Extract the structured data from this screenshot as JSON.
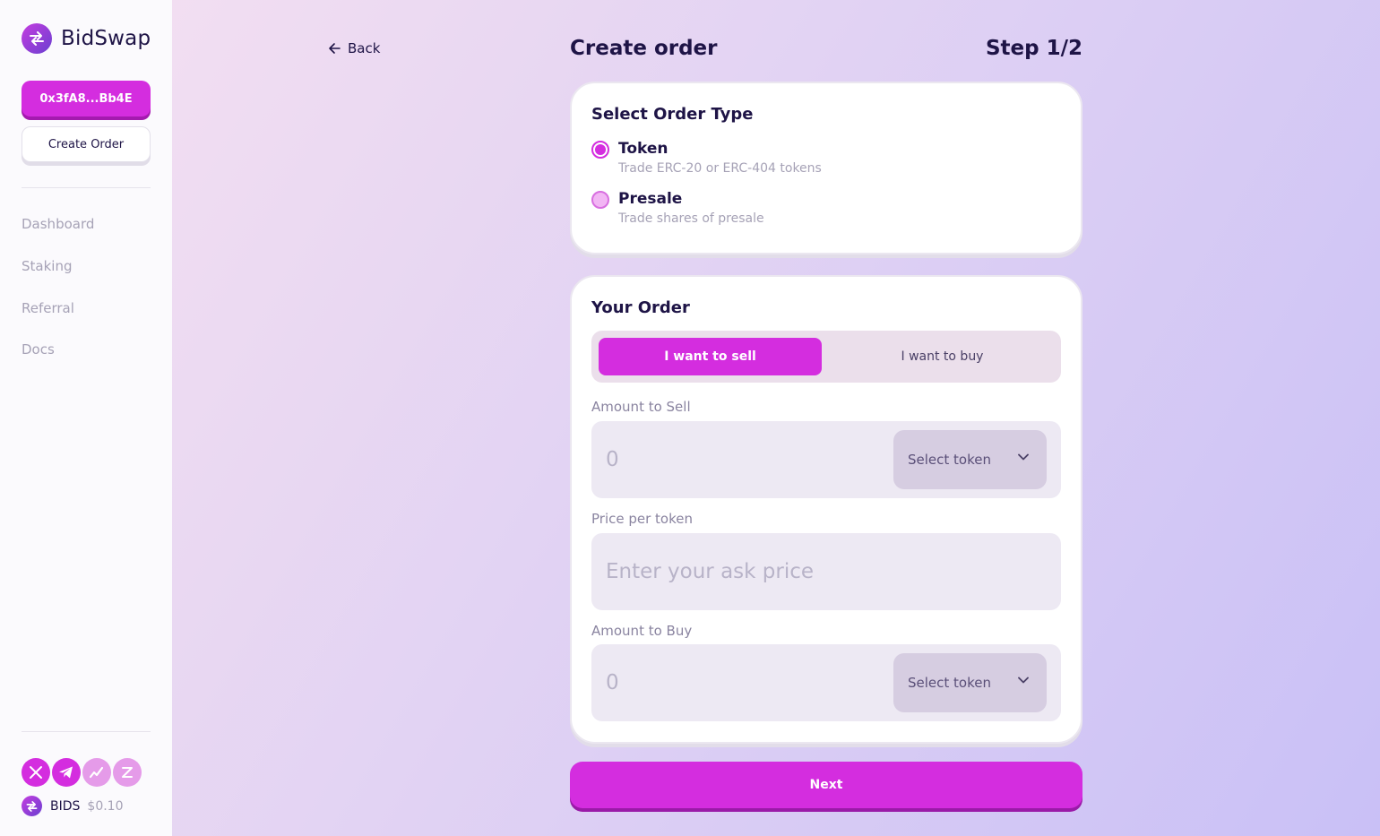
{
  "brand": {
    "name": "BidSwap",
    "logo_icon": "swap-arrows-icon"
  },
  "sidebar": {
    "wallet_address": "0x3fA8...Bb4E",
    "create_order_label": "Create Order",
    "nav": [
      {
        "label": "Dashboard"
      },
      {
        "label": "Staking"
      },
      {
        "label": "Referral"
      },
      {
        "label": "Docs"
      }
    ],
    "socials": [
      "x-icon",
      "telegram-icon",
      "chart-icon",
      "dextools-icon"
    ],
    "token": {
      "symbol": "BIDS",
      "price": "$0.10"
    }
  },
  "header": {
    "back_label": "Back",
    "title": "Create order",
    "step": "Step 1/2"
  },
  "order_type": {
    "title": "Select Order Type",
    "options": [
      {
        "label": "Token",
        "description": "Trade ERC-20 or ERC-404 tokens",
        "selected": true
      },
      {
        "label": "Presale",
        "description": "Trade shares of presale",
        "selected": false
      }
    ]
  },
  "your_order": {
    "title": "Your Order",
    "tabs": [
      {
        "label": "I want to sell",
        "active": true
      },
      {
        "label": "I want to buy",
        "active": false
      }
    ],
    "amount_sell": {
      "label": "Amount to Sell",
      "placeholder": "0",
      "token_label": "Select token"
    },
    "price": {
      "label": "Price per token",
      "placeholder": "Enter your ask price"
    },
    "amount_buy": {
      "label": "Amount to Buy",
      "placeholder": "0",
      "token_label": "Select token"
    }
  },
  "next_label": "Next",
  "colors": {
    "accent": "#d42ddf",
    "text": "#1e1446",
    "muted": "#a6a2b6"
  }
}
